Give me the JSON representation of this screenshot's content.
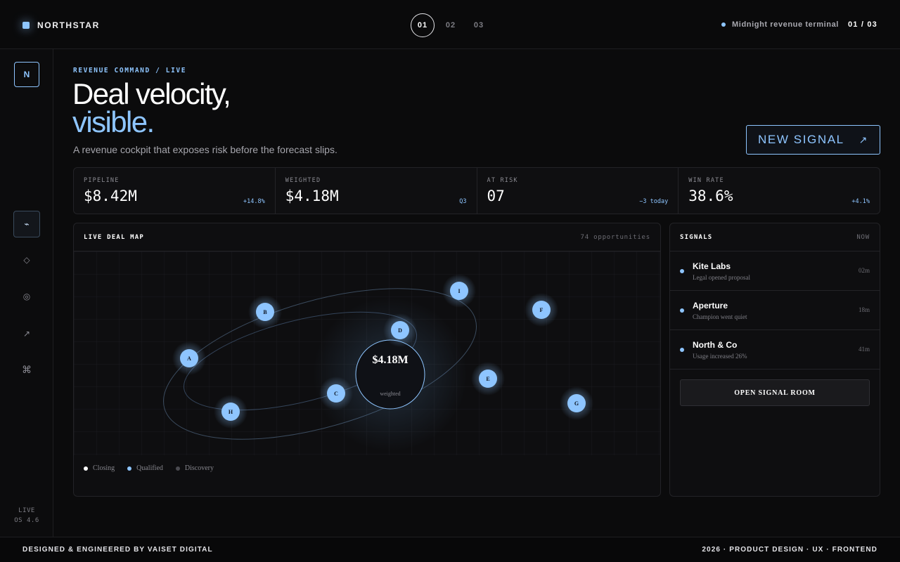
{
  "brand": {
    "name": "NORTHSTAR"
  },
  "pager": [
    "01",
    "02",
    "03"
  ],
  "top_right": {
    "label": "Midnight revenue terminal",
    "page_count": "01 / 03"
  },
  "sidebar": {
    "logo": "N",
    "items": [
      {
        "icon": "pulse-icon",
        "glyph": "⌁"
      },
      {
        "icon": "diamond-icon",
        "glyph": "◇"
      },
      {
        "icon": "target-icon",
        "glyph": "◎"
      },
      {
        "icon": "arrow-up-right-icon",
        "glyph": "↗"
      },
      {
        "icon": "command-icon",
        "glyph": "⌘"
      }
    ],
    "status_line1": "LIVE",
    "status_line2": "OS 4.6"
  },
  "hero": {
    "eyebrow": "REVENUE COMMAND / LIVE",
    "title_line1": "Deal velocity,",
    "title_line2": "visible.",
    "subtitle": "A revenue cockpit that exposes risk before the forecast slips.",
    "cta": "NEW SIGNAL",
    "cta_icon": "↗"
  },
  "metrics": [
    {
      "label": "PIPELINE",
      "value": "$8.42M",
      "delta": "+14.8%"
    },
    {
      "label": "WEIGHTED",
      "value": "$4.18M",
      "delta": "Q3"
    },
    {
      "label": "AT RISK",
      "value": "07",
      "delta": "−3 today"
    },
    {
      "label": "WIN RATE",
      "value": "38.6%",
      "delta": "+4.1%"
    }
  ],
  "deal_map": {
    "title": "LIVE DEAL MAP",
    "meta": "74 opportunities",
    "center_value": "$4.18M",
    "center_label": "weighted",
    "nodes": [
      "A",
      "B",
      "C",
      "D",
      "E",
      "F",
      "G",
      "H",
      "I"
    ],
    "legend": [
      {
        "label": "Closing",
        "color": "#ffffff"
      },
      {
        "label": "Qualified",
        "color": "#8ec5ff"
      },
      {
        "label": "Discovery",
        "color": "#4a4a50"
      }
    ]
  },
  "signals": {
    "title": "SIGNALS",
    "meta": "NOW",
    "items": [
      {
        "name": "Kite Labs",
        "desc": "Legal opened proposal",
        "time": "02m"
      },
      {
        "name": "Aperture",
        "desc": "Champion went quiet",
        "time": "18m"
      },
      {
        "name": "North & Co",
        "desc": "Usage increased 26%",
        "time": "41m"
      }
    ],
    "button": "OPEN SIGNAL ROOM"
  },
  "footer": {
    "left": "DESIGNED & ENGINEERED BY VAISET DIGITAL",
    "right": "2026 · PRODUCT DESIGN · UX · FRONTEND"
  },
  "colors": {
    "accent": "#8ec5ff",
    "background": "#0b0b0c"
  }
}
